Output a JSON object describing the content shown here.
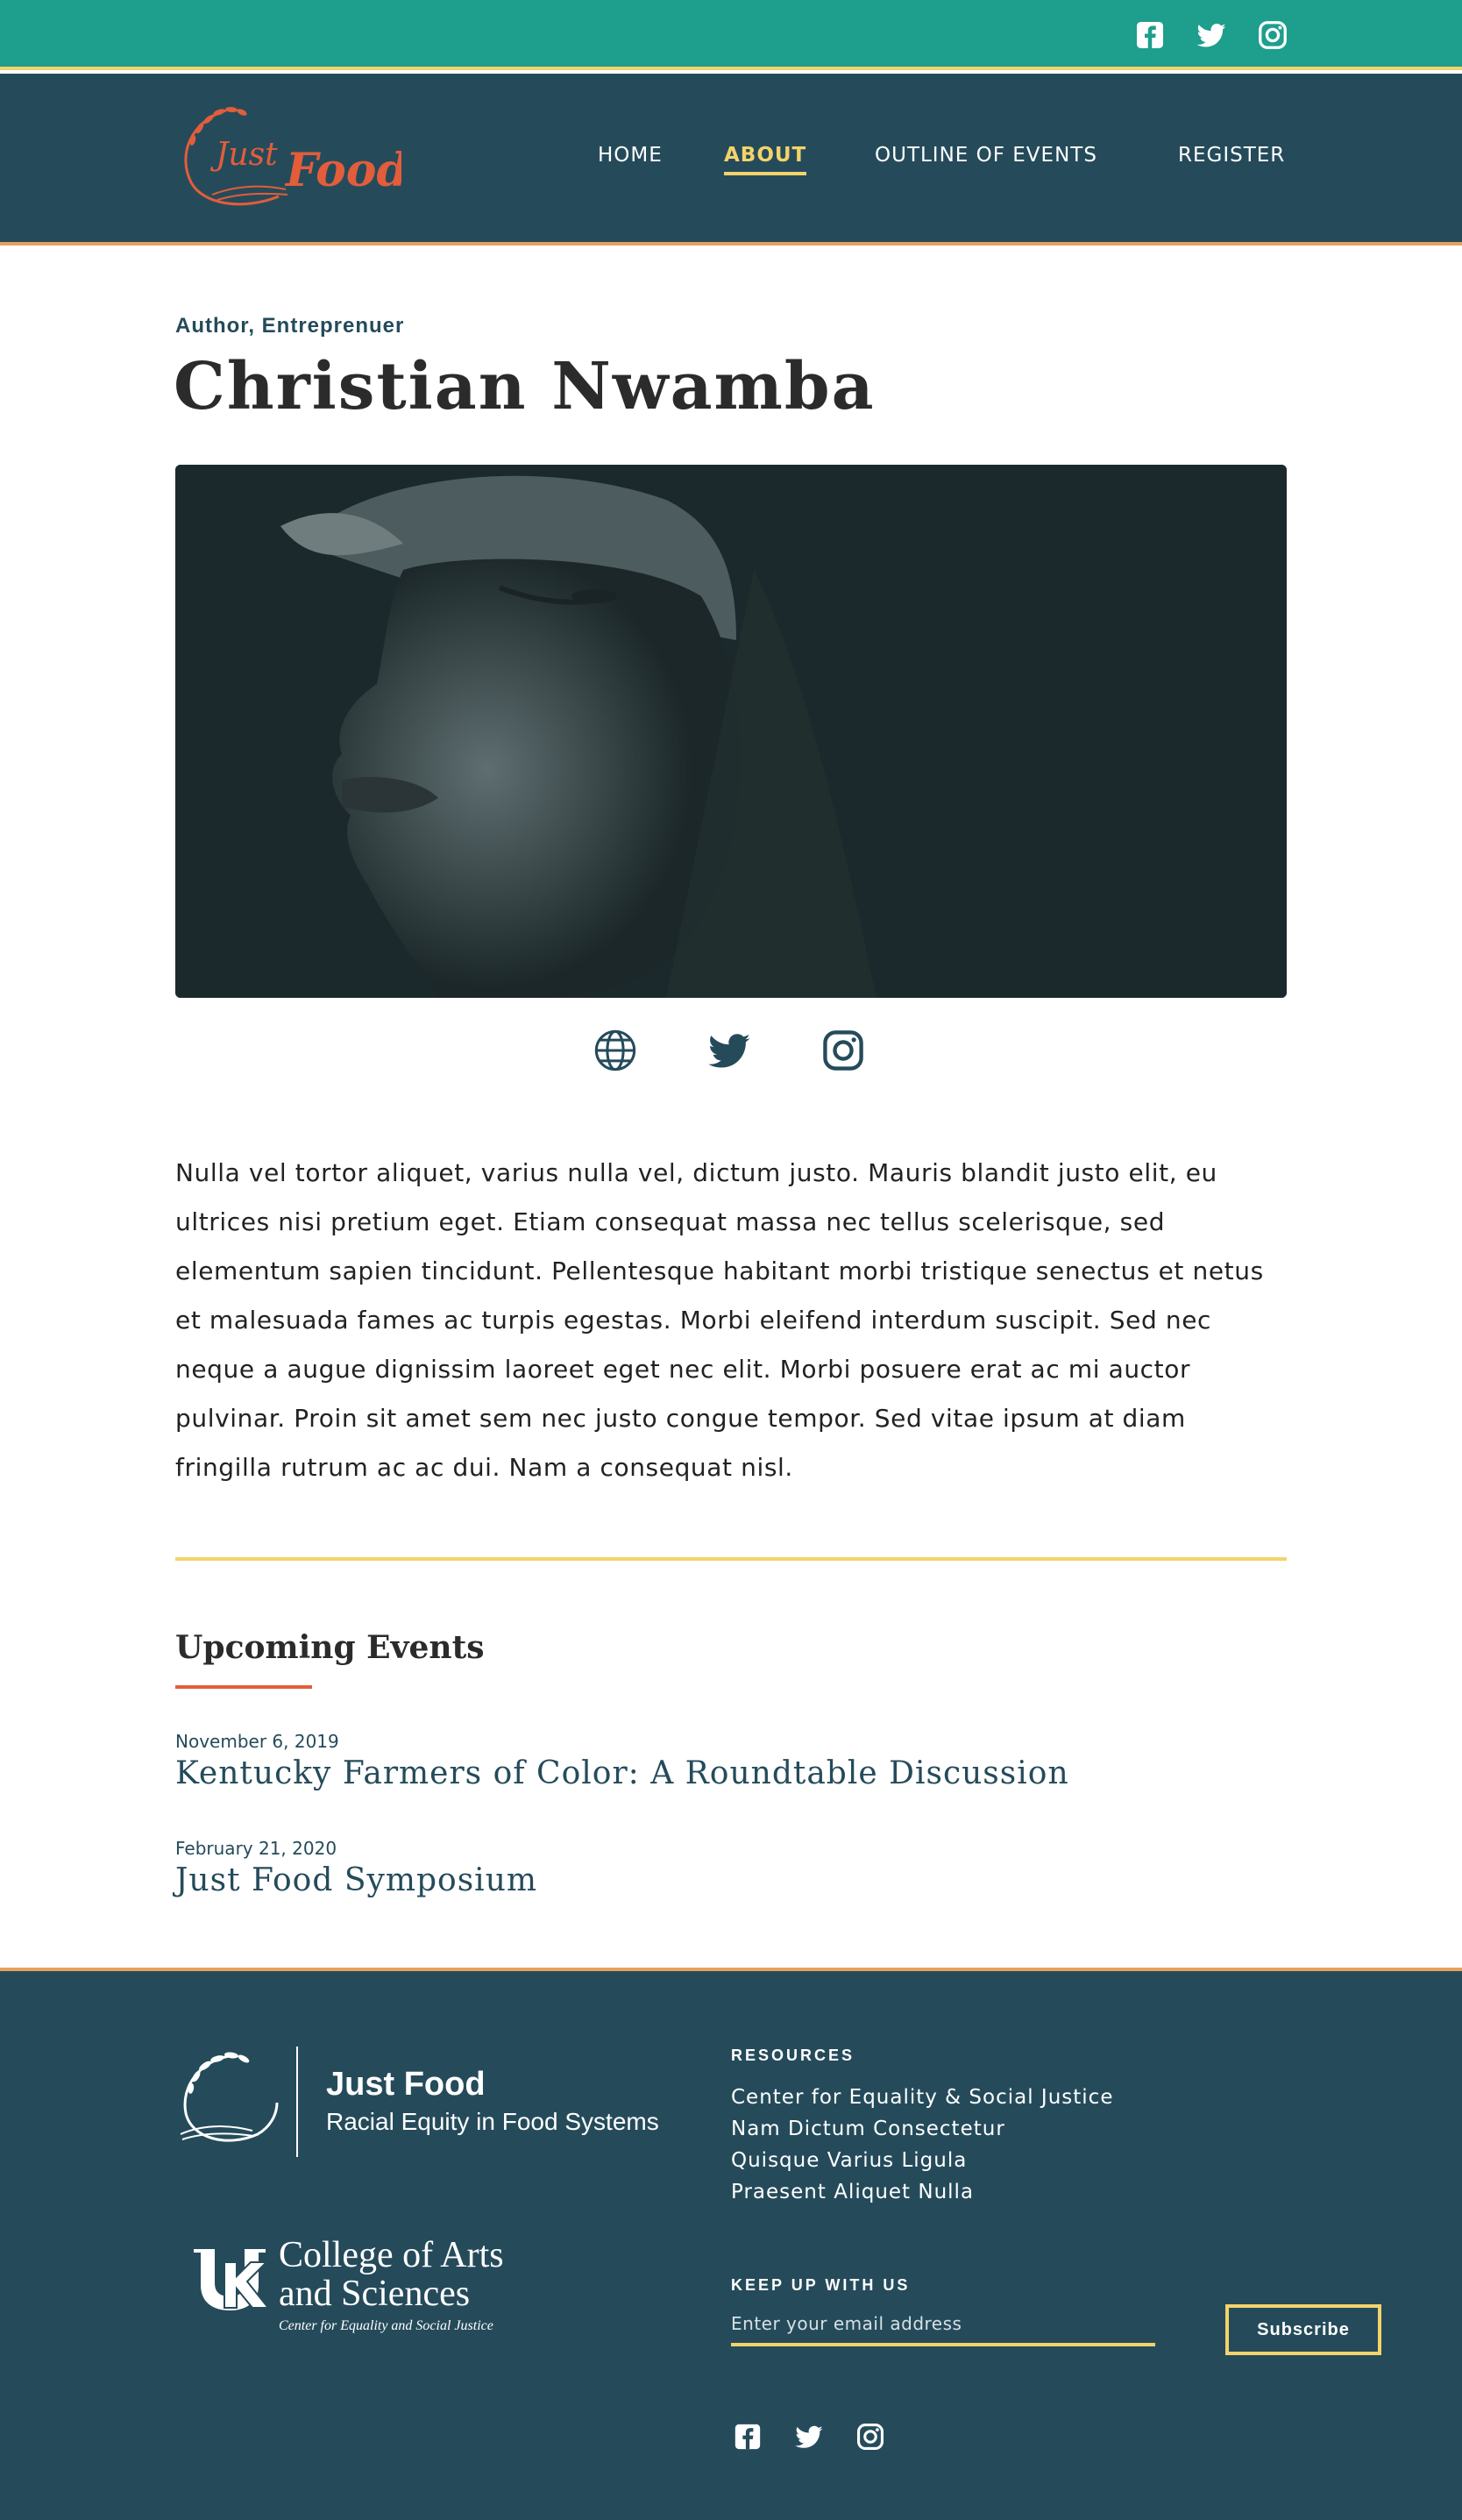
{
  "colors": {
    "topbar": "#1e9e8c",
    "header": "#254b5b",
    "accent_yellow": "#f3d36a",
    "accent_orange": "#e7a15e",
    "brand_red": "#e35d3b"
  },
  "topbar": {
    "social_icons": [
      "facebook-icon",
      "twitter-icon",
      "instagram-icon"
    ]
  },
  "header": {
    "logo_text": [
      "Just",
      "Food"
    ],
    "nav": [
      {
        "label": "HOME",
        "active": false
      },
      {
        "label": "ABOUT",
        "active": true
      },
      {
        "label": "OUTLINE OF EVENTS",
        "active": false
      },
      {
        "label": "REGISTER",
        "active": false
      }
    ]
  },
  "profile": {
    "role": "Author, Entreprenuer",
    "name": "Christian Nwamba",
    "links": [
      "globe-icon",
      "twitter-icon",
      "instagram-icon"
    ],
    "bio": "Nulla vel tortor aliquet, varius nulla vel, dictum justo. Mauris blandit justo elit, eu ultrices nisi pretium eget. Etiam consequat massa nec tellus scelerisque, sed elementum sapien tincidunt. Pellentesque habitant morbi tristique senectus et netus et malesuada fames ac turpis egestas. Morbi eleifend interdum suscipit. Sed nec neque a augue dignissim laoreet eget nec elit. Morbi posuere erat ac mi auctor pulvinar. Proin sit amet sem nec justo congue tempor. Sed vitae ipsum at diam fringilla rutrum ac ac dui. Nam a consequat nisl."
  },
  "events": {
    "heading": "Upcoming Events",
    "items": [
      {
        "date": "November 6, 2019",
        "title": "Kentucky Farmers of Color: A Roundtable Discussion"
      },
      {
        "date": "February 21, 2020",
        "title": "Just Food Symposium"
      }
    ]
  },
  "footer": {
    "brand": "Just Food",
    "tagline": "Racial Equity in Food Systems",
    "college": [
      "College of Arts",
      "and Sciences"
    ],
    "college_sub": "Center for Equality and Social Justice",
    "resources_heading": "RESOURCES",
    "resources": [
      "Center for Equality & Social Justice",
      "Nam Dictum Consectetur",
      "Quisque Varius Ligula",
      "Praesent Aliquet Nulla"
    ],
    "newsletter_heading": "KEEP UP WITH US",
    "email_placeholder": "Enter your email address",
    "subscribe_label": "Subscribe",
    "social_icons": [
      "facebook-icon",
      "twitter-icon",
      "instagram-icon"
    ]
  }
}
